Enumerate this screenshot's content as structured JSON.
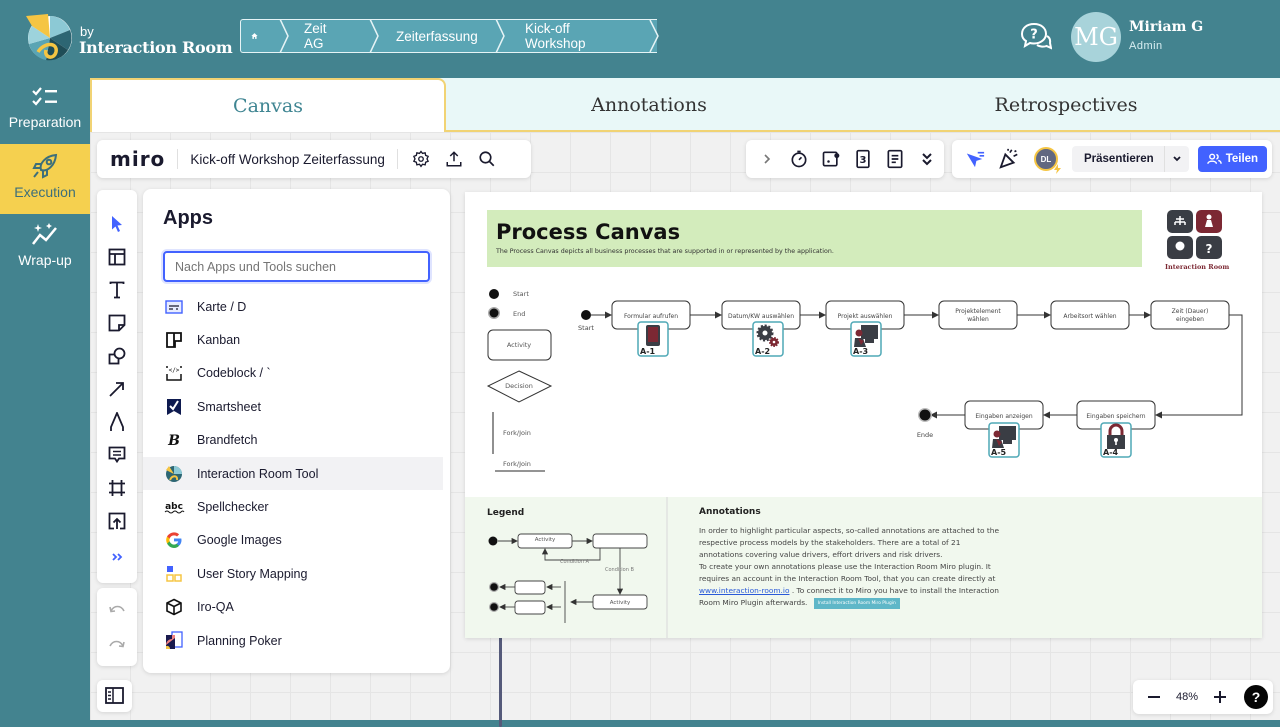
{
  "brand": {
    "by": "by",
    "name": "Interaction Room"
  },
  "breadcrumb": [
    {
      "label": "",
      "icon": "home-icon"
    },
    {
      "label": "Zeit AG"
    },
    {
      "label": "Zeiterfassung"
    },
    {
      "label": "Kick-off Workshop"
    }
  ],
  "user": {
    "initials": "MG",
    "name": "Miriam G",
    "role": "Admin"
  },
  "sidenav": [
    {
      "label": "Preparation",
      "icon": "checklist-icon",
      "active": false
    },
    {
      "label": "Execution",
      "icon": "rocket-icon",
      "active": true
    },
    {
      "label": "Wrap-up",
      "icon": "sparkle-chart-icon",
      "active": false
    }
  ],
  "tabs": [
    {
      "label": "Canvas",
      "active": true
    },
    {
      "label": "Annotations",
      "active": false
    },
    {
      "label": "Retrospectives",
      "active": false
    }
  ],
  "miro": {
    "logo": "miro",
    "board_title": "Kick-off Workshop Zeiterfassung",
    "collab": {
      "avatar_initials": "DL",
      "present_label": "Präsentieren",
      "share_label": "Teilen"
    },
    "zoom_level": "48%",
    "help_label": "?"
  },
  "apps_panel": {
    "title": "Apps",
    "search_placeholder": "Nach Apps und Tools suchen",
    "items": [
      {
        "label": "Karte / D",
        "icon": "card-icon"
      },
      {
        "label": "Kanban",
        "icon": "kanban-icon"
      },
      {
        "label": "Codeblock / `",
        "icon": "codeblock-icon"
      },
      {
        "label": "Smartsheet",
        "icon": "smartsheet-icon"
      },
      {
        "label": "Brandfetch",
        "icon": "brandfetch-icon"
      },
      {
        "label": "Interaction Room Tool",
        "icon": "interaction-room-icon",
        "hover": true
      },
      {
        "label": "Spellchecker",
        "icon": "spellchecker-icon"
      },
      {
        "label": "Google Images",
        "icon": "google-icon"
      },
      {
        "label": "User Story Mapping",
        "icon": "story-map-icon"
      },
      {
        "label": "Iro-QA",
        "icon": "cube-icon"
      },
      {
        "label": "Planning Poker",
        "icon": "planning-poker-icon"
      }
    ]
  },
  "canvas": {
    "title": "Process Canvas",
    "subtitle": "The Process Canvas depicts all business processes that are supported in or represented by the application.",
    "logo_caption": "Interaction Room",
    "shape_legend": {
      "start": "Start",
      "end": "End",
      "activity": "Activity",
      "decision": "Decision",
      "fork_join_v": "Fork/Join",
      "fork_join_h": "Fork/Join"
    },
    "process": {
      "start_label": "Start",
      "end_label": "Ende",
      "activities": [
        "Formular aufrufen",
        "Datum/KW auswählen",
        "Projekt auswählen",
        "Projektelement wählen",
        "Arbeitsort wählen",
        "Zeit (Dauer) eingeben",
        "Eingaben speichern",
        "Eingaben anzeigen"
      ],
      "annotations": [
        {
          "id": "A-1",
          "icon": "mobile-icon"
        },
        {
          "id": "A-2",
          "icon": "gears-icon"
        },
        {
          "id": "A-3",
          "icon": "user-screen-icon"
        },
        {
          "id": "A-4",
          "icon": "lock-icon"
        },
        {
          "id": "A-5",
          "icon": "user-screen-icon"
        }
      ]
    },
    "legend": {
      "title": "Legend",
      "activity": "Activity",
      "condition_a": "Condition A",
      "condition_b": "Condition B"
    },
    "annotations_info": {
      "title": "Annotations",
      "p1": "In order to highlight particular aspects, so-called annotations are attached to the respective process models by the stakeholders. There are a total of 21 annotations covering value drivers, effort drivers and risk drivers.",
      "p2_a": "To create your own annotations please use the Interaction Room Miro plugin. It requires an account in the Interaction Room Tool, that you can create directly at ",
      "link": "www.interaction-room.io",
      "p2_b": " . To connect it to Miro you have to install the Interaction Room Miro Plugin afterwards.",
      "button": "Install Interaction Room Miro Plugin"
    }
  }
}
